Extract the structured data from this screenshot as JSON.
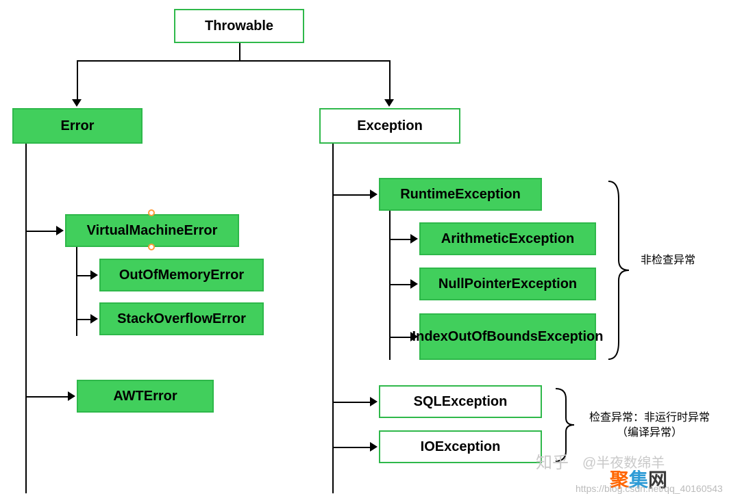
{
  "nodes": {
    "throwable": "Throwable",
    "error": "Error",
    "exception": "Exception",
    "virtualMachineError": "VirtualMachineError",
    "outOfMemoryError": "OutOfMemoryError",
    "stackOverflowError": "StackOverflowError",
    "awtError": "AWTError",
    "runtimeException": "RuntimeException",
    "arithmeticException": "ArithmeticException",
    "nullPointerException": "NullPointerException",
    "indexOutOfBoundsException": "IndexOutOfBoundsException",
    "sqlException": "SQLException",
    "ioException": "IOException"
  },
  "annotations": {
    "unchecked": "非检查异常",
    "checked_line1": "检查异常：非运行时异常",
    "checked_line2": "（编译异常）"
  },
  "watermark": {
    "zhihu_logo": "知乎",
    "zhihu_text": "@半夜数绵羊",
    "site_c1": "聚",
    "site_c2": "集",
    "site_c3": "网",
    "csdn": "https://blog.csdn.net/qq_40160543"
  }
}
